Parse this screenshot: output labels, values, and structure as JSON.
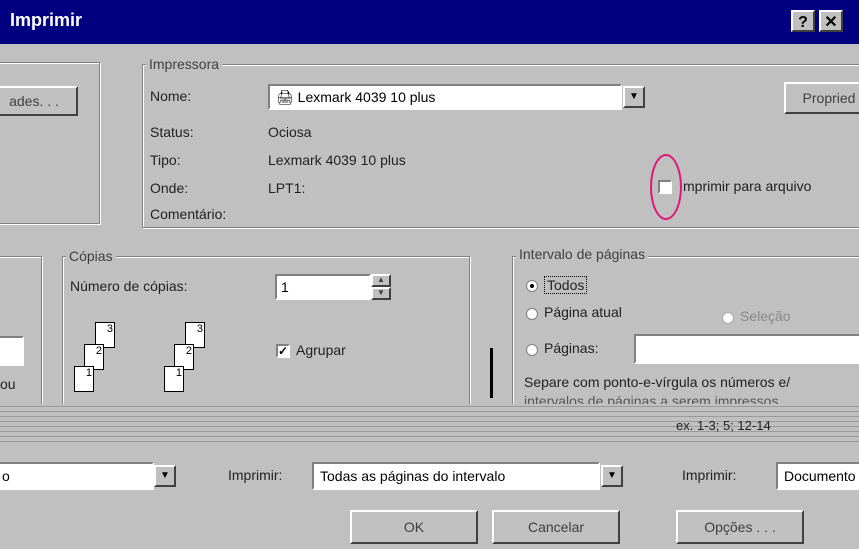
{
  "window": {
    "title": "Imprimir",
    "help_label": "?",
    "close_label": "✕"
  },
  "left_panel": {
    "button_label": "ades. . ."
  },
  "printer": {
    "group_title": "Impressora",
    "name_label": "Nome:",
    "name_value": "Lexmark 4039 10 plus",
    "properties_label": "Propried",
    "status_label": "Status:",
    "status_value": "Ociosa",
    "type_label": "Tipo:",
    "type_value": "Lexmark 4039 10 plus",
    "where_label": "Onde:",
    "where_value": "LPT1:",
    "comment_label": "Comentário:",
    "print_to_file_label": "mprimir para arquivo"
  },
  "copies": {
    "group_title": "Cópias",
    "number_label": "Número de cópias:",
    "number_value": "1",
    "collate_label": "Agrupar",
    "collate_checked": "✓",
    "page_numbers": [
      "1",
      "2",
      "3"
    ]
  },
  "page_range": {
    "group_title": "Intervalo de páginas",
    "all_label": "Todos",
    "current_label": "Página atual",
    "selection_label": "Seleção",
    "pages_label": "Páginas:",
    "hint_line1": "Separe com ponto-e-vírgula os números e/",
    "hint_line2": "intervalos de páginas a serem impressos",
    "example": "ex. 1-3; 5; 12-14"
  },
  "left_partial": {
    "text": "ou"
  },
  "bottom": {
    "print_label": "Imprimir:",
    "print_value": "Todas as páginas do intervalo",
    "print_what_label": "Imprimir:",
    "print_what_value": "Documento",
    "ok_label": "OK",
    "cancel_label": "Cancelar",
    "options_label": "Opções . . .",
    "left_value": "o"
  }
}
